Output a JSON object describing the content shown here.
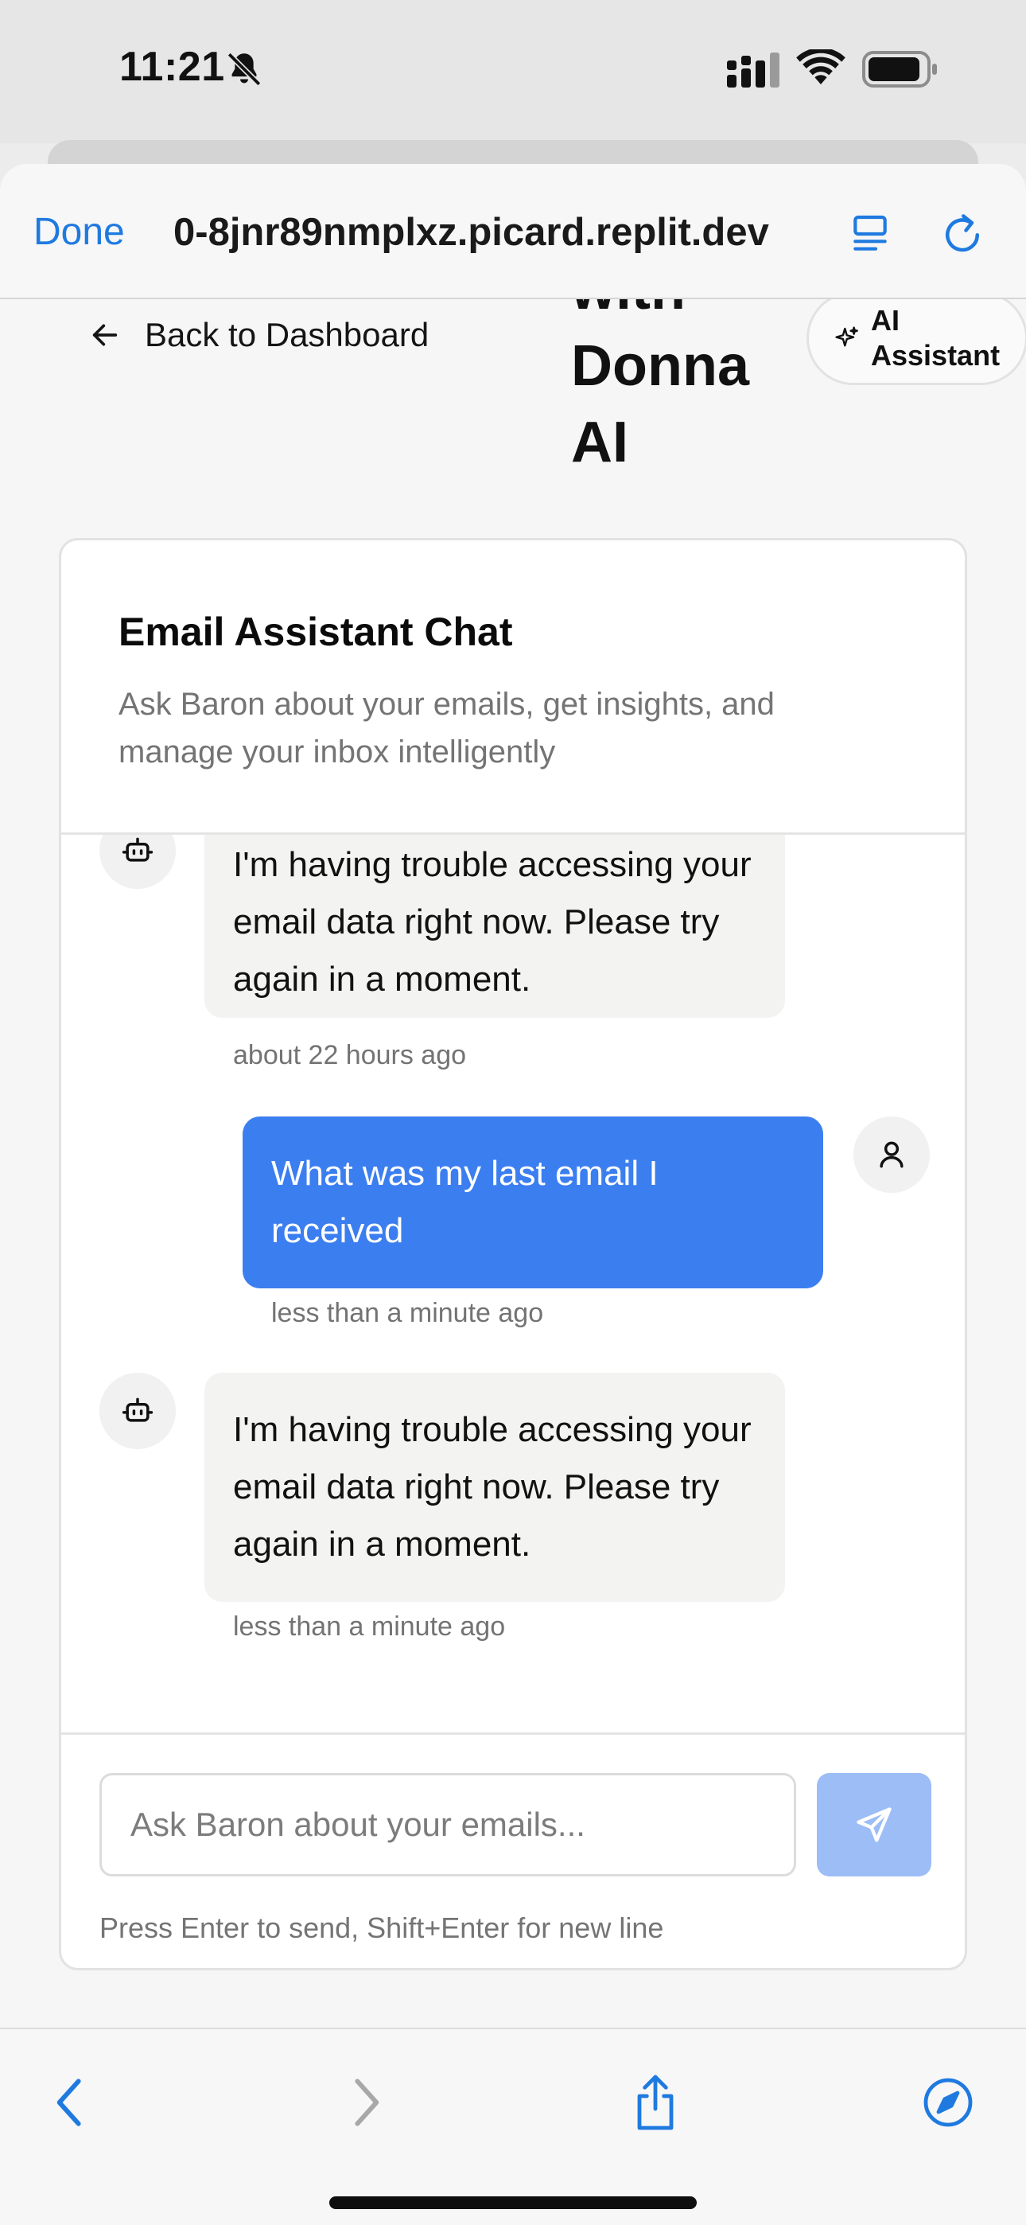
{
  "status_bar": {
    "time": "11:21"
  },
  "browser": {
    "done_label": "Done",
    "url": "0-8jnr89nmplxz.picard.replit.dev"
  },
  "page": {
    "back_label": "Back to Dashboard",
    "title_partial": "with",
    "title_line2": "Donna",
    "title_line3": "AI",
    "ai_badge": "AI Assistant"
  },
  "chat": {
    "title": "Email Assistant Chat",
    "description": "Ask Baron about your emails, get insights, and manage your inbox intelligently",
    "messages": [
      {
        "role": "assistant",
        "text": "I'm having trouble accessing your email data right now. Please try again in a moment.",
        "time": "about 22 hours ago"
      },
      {
        "role": "user",
        "text": "What was my last email I received",
        "time": "less than a minute ago"
      },
      {
        "role": "assistant",
        "text": "I'm having trouble accessing your email data right now. Please try again in a moment.",
        "time": "less than a minute ago"
      }
    ],
    "input_placeholder": "Ask Baron about your emails...",
    "input_value": "",
    "hint": "Press Enter to send, Shift+Enter for new line"
  },
  "colors": {
    "user_bubble": "#3b7ef0",
    "send_button_disabled": "#9cbdf6",
    "ios_blue": "#1f7ae0"
  },
  "icons": {
    "status": [
      "bell-slash-icon",
      "cellular-signal-icon",
      "wifi-icon",
      "battery-icon"
    ],
    "browser": [
      "reader-mode-icon",
      "reload-icon"
    ],
    "toolbar": [
      "back-arrow-icon",
      "forward-arrow-icon",
      "share-icon",
      "compass-icon"
    ]
  }
}
